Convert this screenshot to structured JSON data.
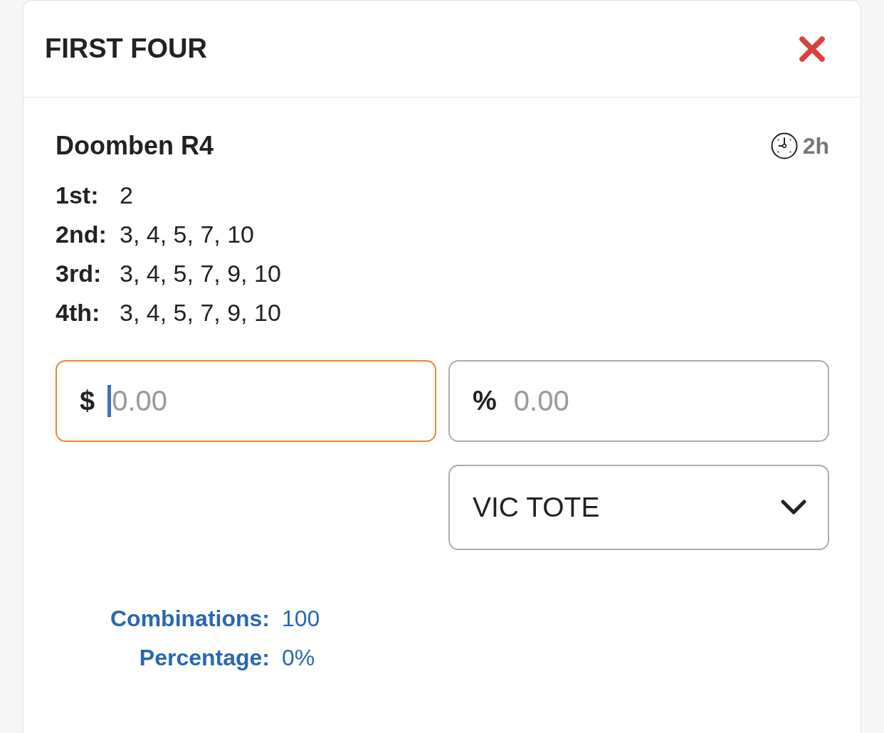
{
  "header": {
    "title": "FIRST FOUR"
  },
  "race": {
    "name": "Doomben R4",
    "time_to_start": "2h"
  },
  "selections": [
    {
      "position": "1st:",
      "runners": "2"
    },
    {
      "position": "2nd:",
      "runners": "3, 4, 5, 7, 10"
    },
    {
      "position": "3rd:",
      "runners": "3, 4, 5, 7, 9, 10"
    },
    {
      "position": "4th:",
      "runners": "3, 4, 5, 7, 9, 10"
    }
  ],
  "fields": [
    {
      "prefix": "$",
      "placeholder": "0.00",
      "focused": true
    },
    {
      "prefix": "%",
      "placeholder": "0.00",
      "focused": false
    }
  ],
  "tote_select": {
    "value": "VIC TOTE"
  },
  "summary": [
    {
      "label": "Combinations:",
      "value": "100"
    },
    {
      "label": "Percentage:",
      "value": "0%"
    }
  ]
}
